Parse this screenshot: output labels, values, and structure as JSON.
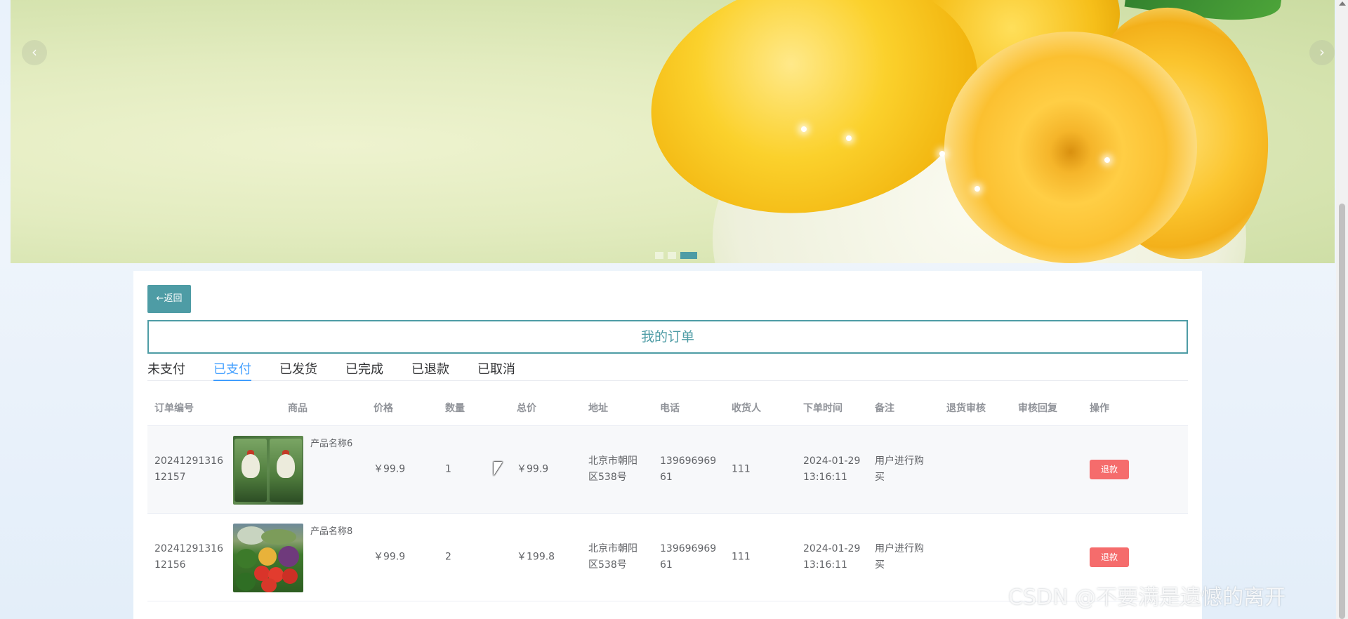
{
  "banner": {
    "prev_label": "‹",
    "next_label": "›",
    "slide_count": 3,
    "active_slide": 3
  },
  "back_button": {
    "label": "←返回"
  },
  "page_title": "我的订单",
  "tabs": [
    {
      "label": "未支付",
      "active": false
    },
    {
      "label": "已支付",
      "active": true
    },
    {
      "label": "已发货",
      "active": false
    },
    {
      "label": "已完成",
      "active": false
    },
    {
      "label": "已退款",
      "active": false
    },
    {
      "label": "已取消",
      "active": false
    }
  ],
  "table": {
    "columns": {
      "id": "订单编号",
      "goods": "商品",
      "price": "价格",
      "qty": "数量",
      "total": "总价",
      "addr": "地址",
      "phone": "电话",
      "recv": "收货人",
      "time": "下单时间",
      "note": "备注",
      "refund": "退货审核",
      "reply": "审核回复",
      "op": "操作"
    },
    "rows": [
      {
        "id_line1": "20241291316",
        "id_line2": "12157",
        "product_name": "产品名称6",
        "price": "￥99.9",
        "qty": "1",
        "total": "￥99.9",
        "addr_line1": "北京市朝阳",
        "addr_line2": "区538号",
        "phone_line1": "139696969",
        "phone_line2": "61",
        "recv": "111",
        "time_line1": "2024-01-29",
        "time_line2": "13:16:11",
        "note_line1": "用户进行购",
        "note_line2": "买",
        "refund_status": "",
        "reply": "",
        "action": "退款"
      },
      {
        "id_line1": "20241291316",
        "id_line2": "12156",
        "product_name": "产品名称8",
        "price": "￥99.9",
        "qty": "2",
        "total": "￥199.8",
        "addr_line1": "北京市朝阳",
        "addr_line2": "区538号",
        "phone_line1": "139696969",
        "phone_line2": "61",
        "recv": "111",
        "time_line1": "2024-01-29",
        "time_line2": "13:16:11",
        "note_line1": "用户进行购",
        "note_line2": "买",
        "refund_status": "",
        "reply": "",
        "action": "退款"
      }
    ]
  },
  "watermark": "CSDN @不要满是遗憾的离开",
  "colors": {
    "accent": "#4e9ca5",
    "tab_active": "#409eff",
    "danger": "#f56c6c"
  }
}
